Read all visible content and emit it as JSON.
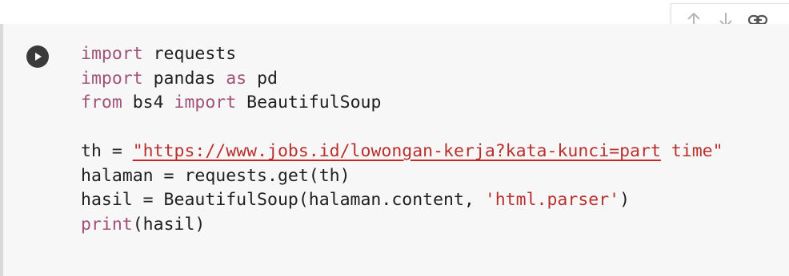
{
  "toolbar": {
    "buttons": [
      {
        "icon": "arrow-up-icon"
      },
      {
        "icon": "arrow-down-icon"
      },
      {
        "icon": "link-icon"
      }
    ]
  },
  "cell": {
    "run_icon": "play-icon",
    "code_lines": [
      {
        "t1": "import",
        "t2": " requests"
      },
      {
        "t1": "import",
        "t2": " pandas ",
        "t3": "as",
        "t4": " pd"
      },
      {
        "t1": "from",
        "t2": " bs4 ",
        "t3": "import",
        "t4": " BeautifulSoup"
      },
      {},
      {
        "t1": "th = ",
        "t2": "\"https://www.jobs.id/lowongan-kerja?kata-kunci=part",
        "t3": " time\""
      },
      {
        "t1": "halaman = requests.get(th)"
      },
      {
        "t1": "hasil = BeautifulSoup(halaman.content, ",
        "t2": "'html.parser'",
        "t3": ")"
      },
      {
        "t1": "print",
        "t2": "(hasil)"
      }
    ]
  },
  "colors": {
    "keyword": "#a0527a",
    "string": "#b8312f",
    "cell_background": "#f7f7f7"
  }
}
